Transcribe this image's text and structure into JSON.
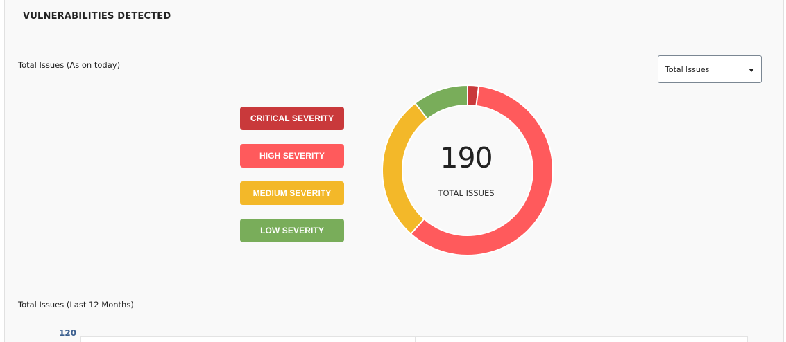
{
  "panel": {
    "title": "VULNERABILITIES DETECTED"
  },
  "summary": {
    "label": "Total Issues (As on today)",
    "dropdown": {
      "selected": "Total Issues"
    },
    "legend": [
      {
        "label": "CRITICAL SEVERITY",
        "color": "#c9393b"
      },
      {
        "label": "HIGH SEVERITY",
        "color": "#ff5a5c"
      },
      {
        "label": "MEDIUM SEVERITY",
        "color": "#f3b829"
      },
      {
        "label": "LOW SEVERITY",
        "color": "#79ad5a"
      }
    ],
    "total_value": "190",
    "total_caption": "TOTAL ISSUES"
  },
  "chart_data": {
    "type": "pie",
    "categories": [
      "CRITICAL SEVERITY",
      "HIGH SEVERITY",
      "MEDIUM SEVERITY",
      "LOW SEVERITY"
    ],
    "values": [
      4,
      113,
      53,
      20
    ],
    "colors": [
      "#c9393b",
      "#ff5a5c",
      "#f3b829",
      "#79ad5a"
    ]
  },
  "trend": {
    "label": "Total Issues (Last 12 Months)",
    "y_tick_top": "120"
  }
}
